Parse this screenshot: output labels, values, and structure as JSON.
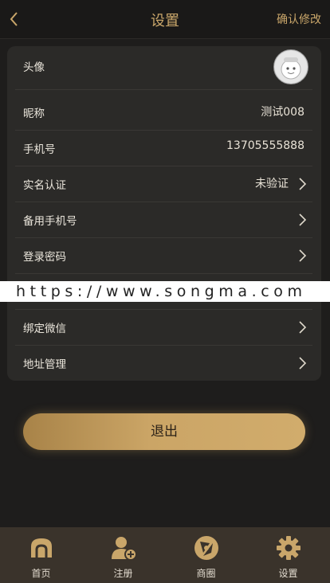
{
  "header": {
    "title": "设置",
    "confirm_label": "确认修改"
  },
  "rows": [
    {
      "label": "头像"
    },
    {
      "label": "昵称",
      "value": "测试008"
    },
    {
      "label": "手机号",
      "value": "13705555888"
    },
    {
      "label": "实名认证",
      "value": "未验证"
    },
    {
      "label": "备用手机号"
    },
    {
      "label": "登录密码"
    },
    {
      "label": ""
    },
    {
      "label": "绑定微信"
    },
    {
      "label": "地址管理"
    }
  ],
  "watermark": "https://www.songma.com",
  "logout_label": "退出",
  "tabs": [
    {
      "label": "首页",
      "icon": "home-icon"
    },
    {
      "label": "注册",
      "icon": "add-user-icon"
    },
    {
      "label": "商圈",
      "icon": "aperture-icon"
    },
    {
      "label": "设置",
      "icon": "gear-icon"
    }
  ],
  "colors": {
    "accent": "#c9a66a",
    "background": "#1e1d1c",
    "card": "#2b2a28",
    "tabbar": "#3a332b"
  }
}
